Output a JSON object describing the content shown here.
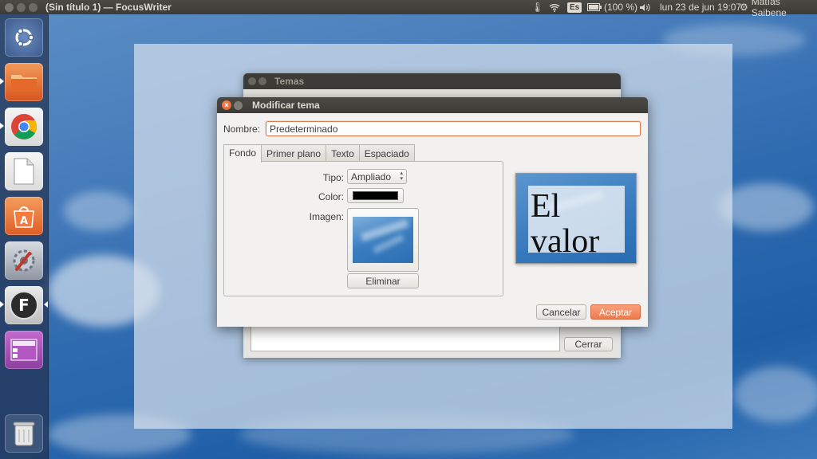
{
  "topbar": {
    "window_title": "(Sin título 1) — FocusWriter",
    "keyboard_layout": "Es",
    "battery": "(100 %)",
    "datetime": "lun 23 de jun 19:07",
    "user": "Matías Saibene"
  },
  "launcher": {
    "items": [
      "Ubuntu Dash",
      "Files",
      "Google Chrome",
      "LibreOffice",
      "Ubuntu Software Center",
      "System Settings",
      "FocusWriter",
      "Workspace Switcher",
      "Trash"
    ],
    "focuswriter_glyph": "F"
  },
  "temas_window": {
    "title": "Temas",
    "close_label": "Cerrar"
  },
  "dialog": {
    "title": "Modificar tema",
    "name_label": "Nombre:",
    "name_value": "Predeterminado",
    "tabs": [
      "Fondo",
      "Primer plano",
      "Texto",
      "Espaciado"
    ],
    "active_tab": "Fondo",
    "fondo": {
      "type_label": "Tipo:",
      "type_value": "Ampliado",
      "color_label": "Color:",
      "color_value": "#000000",
      "image_label": "Imagen:",
      "remove_label": "Eliminar"
    },
    "preview_text": "El valor",
    "cancel_label": "Cancelar",
    "ok_label": "Aceptar"
  },
  "colors": {
    "accent": "#ec7a4e",
    "topbar": "#3c3b37"
  }
}
